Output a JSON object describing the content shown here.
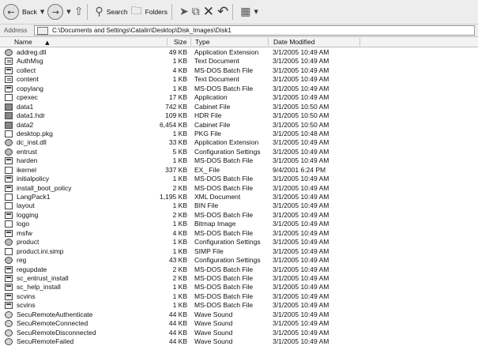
{
  "toolbar": {
    "back_label": "Back",
    "search_label": "Search",
    "folders_label": "Folders"
  },
  "address": {
    "label": "Address",
    "path": "C:\\Documents and Settings\\Catalin\\Desktop\\Disk_Images\\Disk1"
  },
  "columns": {
    "name": "Name",
    "size": "Size",
    "type": "Type",
    "date": "Date Modified"
  },
  "files": [
    {
      "name": "addreg.dll",
      "size": "49 KB",
      "type": "Application Extension",
      "date": "3/1/2005 10:49 AM",
      "icon": "gear"
    },
    {
      "name": "AuthMsg",
      "size": "1 KB",
      "type": "Text Document",
      "date": "3/1/2005 10:49 AM",
      "icon": "txt"
    },
    {
      "name": "collect",
      "size": "4 KB",
      "type": "MS-DOS Batch File",
      "date": "3/1/2005 10:49 AM",
      "icon": "bat"
    },
    {
      "name": "content",
      "size": "1 KB",
      "type": "Text Document",
      "date": "3/1/2005 10:49 AM",
      "icon": "txt"
    },
    {
      "name": "copylang",
      "size": "1 KB",
      "type": "MS-DOS Batch File",
      "date": "3/1/2005 10:49 AM",
      "icon": "bat"
    },
    {
      "name": "cpexec",
      "size": "17 KB",
      "type": "Application",
      "date": "3/1/2005 10:49 AM",
      "icon": "blank"
    },
    {
      "name": "data1",
      "size": "742 KB",
      "type": "Cabinet File",
      "date": "3/1/2005 10:50 AM",
      "icon": "cab"
    },
    {
      "name": "data1.hdr",
      "size": "109 KB",
      "type": "HDR File",
      "date": "3/1/2005 10:50 AM",
      "icon": "cab"
    },
    {
      "name": "data2",
      "size": "6,454 KB",
      "type": "Cabinet File",
      "date": "3/1/2005 10:50 AM",
      "icon": "cab"
    },
    {
      "name": "desktop.pkg",
      "size": "1 KB",
      "type": "PKG File",
      "date": "3/1/2005 10:48 AM",
      "icon": "blank"
    },
    {
      "name": "dc_inst.dll",
      "size": "33 KB",
      "type": "Application Extension",
      "date": "3/1/2005 10:49 AM",
      "icon": "gear"
    },
    {
      "name": "entrust",
      "size": "5 KB",
      "type": "Configuration Settings",
      "date": "3/1/2005 10:49 AM",
      "icon": "gear"
    },
    {
      "name": "harden",
      "size": "1 KB",
      "type": "MS-DOS Batch File",
      "date": "3/1/2005 10:49 AM",
      "icon": "bat"
    },
    {
      "name": "ikernel",
      "size": "337 KB",
      "type": "EX_ File",
      "date": "9/4/2001 6:24 PM",
      "icon": "blank"
    },
    {
      "name": "initialpolicy",
      "size": "1 KB",
      "type": "MS-DOS Batch File",
      "date": "3/1/2005 10:49 AM",
      "icon": "bat"
    },
    {
      "name": "install_boot_policy",
      "size": "2 KB",
      "type": "MS-DOS Batch File",
      "date": "3/1/2005 10:49 AM",
      "icon": "bat"
    },
    {
      "name": "LangPack1",
      "size": "1,195 KB",
      "type": "XML Document",
      "date": "3/1/2005 10:49 AM",
      "icon": "blank"
    },
    {
      "name": "layout",
      "size": "1 KB",
      "type": "BIN File",
      "date": "3/1/2005 10:49 AM",
      "icon": "blank"
    },
    {
      "name": "logging",
      "size": "2 KB",
      "type": "MS-DOS Batch File",
      "date": "3/1/2005 10:49 AM",
      "icon": "bat"
    },
    {
      "name": "logo",
      "size": "1 KB",
      "type": "Bitmap Image",
      "date": "3/1/2005 10:49 AM",
      "icon": "blank"
    },
    {
      "name": "msfw",
      "size": "4 KB",
      "type": "MS-DOS Batch File",
      "date": "3/1/2005 10:49 AM",
      "icon": "bat"
    },
    {
      "name": "product",
      "size": "1 KB",
      "type": "Configuration Settings",
      "date": "3/1/2005 10:49 AM",
      "icon": "gear"
    },
    {
      "name": "product.ini.simp",
      "size": "1 KB",
      "type": "SIMP File",
      "date": "3/1/2005 10:49 AM",
      "icon": "blank"
    },
    {
      "name": "reg",
      "size": "43 KB",
      "type": "Configuration Settings",
      "date": "3/1/2005 10:49 AM",
      "icon": "gear"
    },
    {
      "name": "regupdate",
      "size": "2 KB",
      "type": "MS-DOS Batch File",
      "date": "3/1/2005 10:49 AM",
      "icon": "bat"
    },
    {
      "name": "sc_entrust_install",
      "size": "2 KB",
      "type": "MS-DOS Batch File",
      "date": "3/1/2005 10:49 AM",
      "icon": "bat"
    },
    {
      "name": "sc_help_install",
      "size": "1 KB",
      "type": "MS-DOS Batch File",
      "date": "3/1/2005 10:49 AM",
      "icon": "bat"
    },
    {
      "name": "scvins",
      "size": "1 KB",
      "type": "MS-DOS Batch File",
      "date": "3/1/2005 10:49 AM",
      "icon": "bat"
    },
    {
      "name": "scvins",
      "size": "1 KB",
      "type": "MS-DOS Batch File",
      "date": "3/1/2005 10:49 AM",
      "icon": "bat"
    },
    {
      "name": "SecuRemoteAuthenticate",
      "size": "44 KB",
      "type": "Wave Sound",
      "date": "3/1/2005 10:49 AM",
      "icon": "wav"
    },
    {
      "name": "SecuRemoteConnected",
      "size": "44 KB",
      "type": "Wave Sound",
      "date": "3/1/2005 10:49 AM",
      "icon": "wav"
    },
    {
      "name": "SecuRemoteDisconnected",
      "size": "44 KB",
      "type": "Wave Sound",
      "date": "3/1/2005 10:49 AM",
      "icon": "wav"
    },
    {
      "name": "SecuRemoteFailed",
      "size": "44 KB",
      "type": "Wave Sound",
      "date": "3/1/2005 10:49 AM",
      "icon": "wav"
    }
  ]
}
